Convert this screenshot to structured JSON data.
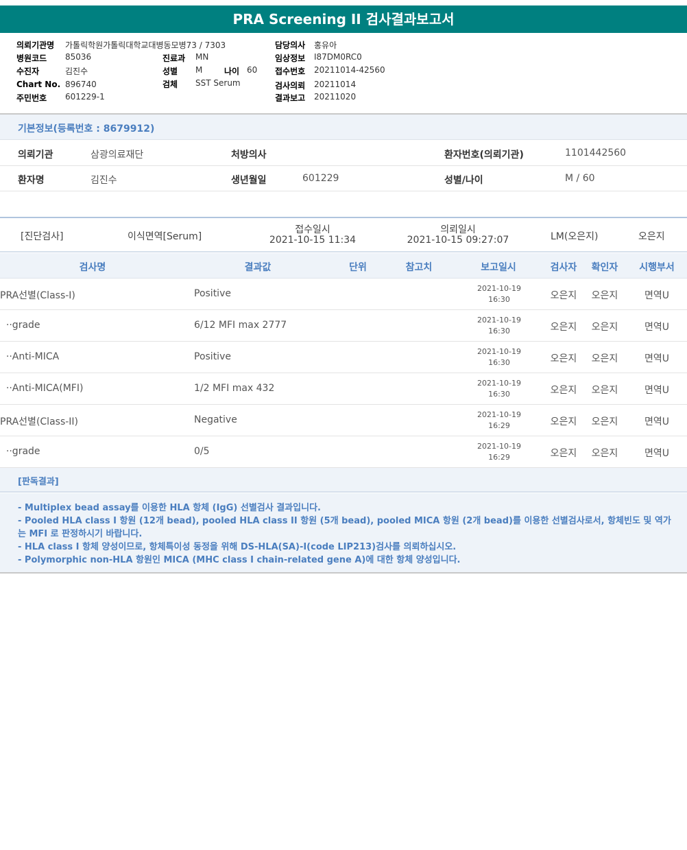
{
  "title": "PRA Screening II 검사결과보고서",
  "header": {
    "hospital_label": "의뢰기관명",
    "hospital_value": "가톨릭학원가톨릭대학교대병동모병73 / 7303",
    "code_label": "병원코드",
    "code_value": "85036",
    "dept_label": "진료과",
    "dept_value": "MN",
    "patient_label": "수진자",
    "patient_value": "김진수",
    "sex_label": "성별",
    "sex_value": "M",
    "age_label": "나이",
    "age_value": "60",
    "chart_label": "Chart No.",
    "chart_value": "896740",
    "specimen_label": "검체",
    "specimen_value": "SST Serum",
    "idno_label": "주민번호",
    "idno_value": "601229-1",
    "doctor_label": "담당의사",
    "doctor_value": "홍유아",
    "clinical_label": "임상정보",
    "clinical_value": "I87DM0RC0",
    "receipt_label": "접수번호",
    "receipt_value": "20211014-42560",
    "request_label": "검사의뢰",
    "request_value": "20211014",
    "report_label": "결과보고",
    "report_value": "20211020"
  },
  "info": {
    "title": "기본정보(등록번호 : 8679912)",
    "org_label": "의뢰기관",
    "org_value": "삼광의료재단",
    "presc_label": "처방의사",
    "presc_value": "",
    "pno_label": "환자번호(의뢰기관)",
    "pno_value": "1101442560",
    "name_label": "환자명",
    "name_value": "김진수",
    "dob_label": "생년월일",
    "dob_value": "601229",
    "sexage_label": "성별/나이",
    "sexage_value": "M / 60"
  },
  "exam": {
    "category": "[진단검사]",
    "type": "이식면역[Serum]",
    "received_label": "접수일시",
    "received_value": "2021-10-15  11:34",
    "requested_label": "의뢰일시",
    "requested_value": "2021-10-15  09:27:07",
    "lm": "LM(오은지)",
    "person": "오은지"
  },
  "columns": {
    "name": "검사명",
    "result": "결과값",
    "unit": "단위",
    "ref": "참고치",
    "date": "보고일시",
    "examiner": "검사자",
    "confirmer": "확인자",
    "dept": "시행부서"
  },
  "rows": [
    {
      "name": "PRA선별(Class-I)",
      "result": "Positive",
      "date": "2021-10-19",
      "time": "16:30",
      "examiner": "오은지",
      "confirmer": "오은지",
      "dept": "면역U"
    },
    {
      "name": "  ··grade",
      "result": "6/12 MFI max 2777",
      "date": "2021-10-19",
      "time": "16:30",
      "examiner": "오은지",
      "confirmer": "오은지",
      "dept": "면역U"
    },
    {
      "name": "  ··Anti-MICA",
      "result": "Positive",
      "date": "2021-10-19",
      "time": "16:30",
      "examiner": "오은지",
      "confirmer": "오은지",
      "dept": "면역U"
    },
    {
      "name": "  ··Anti-MICA(MFI)",
      "result": "1/2 MFI max 432",
      "date": "2021-10-19",
      "time": "16:30",
      "examiner": "오은지",
      "confirmer": "오은지",
      "dept": "면역U"
    },
    {
      "name": "PRA선별(Class-II)",
      "result": "Negative",
      "date": "2021-10-19",
      "time": "16:29",
      "examiner": "오은지",
      "confirmer": "오은지",
      "dept": "면역U"
    },
    {
      "name": "  ··grade",
      "result": "0/5",
      "date": "2021-10-19",
      "time": "16:29",
      "examiner": "오은지",
      "confirmer": "오은지",
      "dept": "면역U"
    }
  ],
  "interpretation": {
    "title": "[판독결과]",
    "lines": [
      "- Multiplex bead assay를 이용한 HLA 항체 (IgG) 선별검사 결과입니다.",
      "- Pooled HLA class I 항원 (12개 bead), pooled HLA class II 항원 (5개 bead), pooled MICA 항원 (2개 bead)를 이용한 선별검사로서, 항체빈도 및 역가",
      "는 MFI 로 판정하시기 바랍니다.",
      "- HLA class I 항체 양성이므로, 항체특이성 동정을 위해 DS-HLA(SA)-I(code LIP213)검사를 의뢰하십시오.",
      "- Polymorphic non-HLA 항원인 MICA (MHC class I chain-related gene A)에 대한 항체 양성입니다."
    ]
  }
}
